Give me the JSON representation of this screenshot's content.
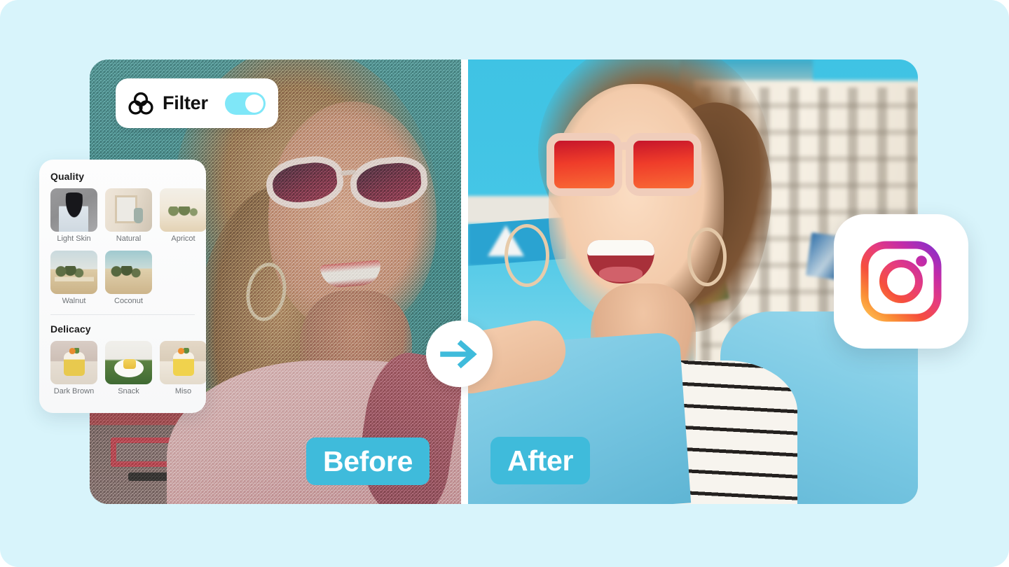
{
  "page": {
    "background_color": "#d8f4fb",
    "accent_color": "#3fbbdb",
    "toggle_color": "#7fe7f8"
  },
  "filter_pill": {
    "icon": "filter-circles-icon",
    "label": "Filter",
    "toggle_state": "on"
  },
  "presets_panel": {
    "groups": [
      {
        "title": "Quality",
        "items": [
          {
            "label": "Light Skin",
            "thumb": "t-lightskin"
          },
          {
            "label": "Natural",
            "thumb": "t-natural"
          },
          {
            "label": "Apricot",
            "thumb": "t-apricot"
          },
          {
            "label": "Walnut",
            "thumb": "t-walnut"
          },
          {
            "label": "Coconut",
            "thumb": "t-coconut"
          }
        ]
      },
      {
        "title": "Delicacy",
        "items": [
          {
            "label": "Dark Brown",
            "thumb": "t-darkbrown"
          },
          {
            "label": "Snack",
            "thumb": "t-snack"
          },
          {
            "label": "Miso",
            "thumb": "t-miso"
          }
        ]
      }
    ]
  },
  "comparison": {
    "before_label": "Before",
    "after_label": "After",
    "arrow_icon": "arrow-right-icon"
  },
  "social_badge": {
    "icon": "instagram-icon",
    "name": "Instagram"
  }
}
